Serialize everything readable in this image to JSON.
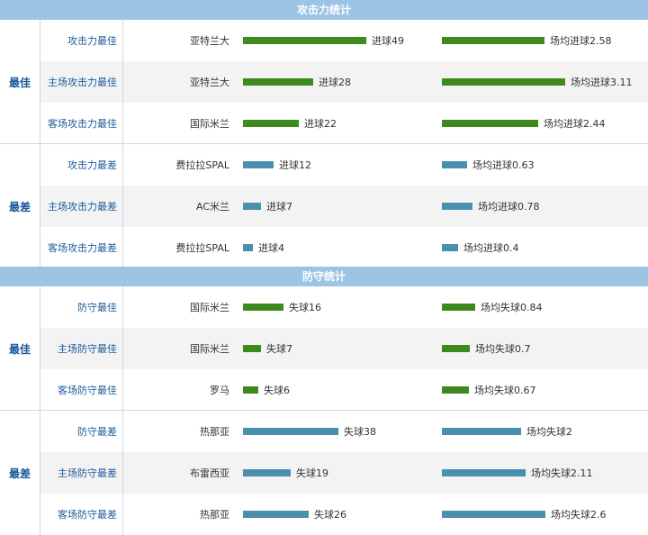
{
  "colors": {
    "header_bg": "#9cc4e4",
    "best_bar": "#3f8a1e",
    "worst_bar": "#4a8fad",
    "label_blue": "#1b5a9a"
  },
  "chart_data": {
    "type": "table",
    "sections": [
      {
        "title": "攻击力统计",
        "groups": [
          {
            "category": "最佳",
            "rows": [
              {
                "label": "攻击力最佳",
                "team": "亚特兰大",
                "total_text": "进球49",
                "total": 49,
                "avg_text": "场均进球2.58",
                "avg": 2.58
              },
              {
                "label": "主场攻击力最佳",
                "team": "亚特兰大",
                "total_text": "进球28",
                "total": 28,
                "avg_text": "场均进球3.11",
                "avg": 3.11
              },
              {
                "label": "客场攻击力最佳",
                "team": "国际米兰",
                "total_text": "进球22",
                "total": 22,
                "avg_text": "场均进球2.44",
                "avg": 2.44
              }
            ]
          },
          {
            "category": "最差",
            "rows": [
              {
                "label": "攻击力最差",
                "team": "费拉拉SPAL",
                "total_text": "进球12",
                "total": 12,
                "avg_text": "场均进球0.63",
                "avg": 0.63
              },
              {
                "label": "主场攻击力最差",
                "team": "AC米兰",
                "total_text": "进球7",
                "total": 7,
                "avg_text": "场均进球0.78",
                "avg": 0.78
              },
              {
                "label": "客场攻击力最差",
                "team": "费拉拉SPAL",
                "total_text": "进球4",
                "total": 4,
                "avg_text": "场均进球0.4",
                "avg": 0.4
              }
            ]
          }
        ]
      },
      {
        "title": "防守统计",
        "groups": [
          {
            "category": "最佳",
            "rows": [
              {
                "label": "防守最佳",
                "team": "国际米兰",
                "total_text": "失球16",
                "total": 16,
                "avg_text": "场均失球0.84",
                "avg": 0.84
              },
              {
                "label": "主场防守最佳",
                "team": "国际米兰",
                "total_text": "失球7",
                "total": 7,
                "avg_text": "场均失球0.7",
                "avg": 0.7
              },
              {
                "label": "客场防守最佳",
                "team": "罗马",
                "total_text": "失球6",
                "total": 6,
                "avg_text": "场均失球0.67",
                "avg": 0.67
              }
            ]
          },
          {
            "category": "最差",
            "rows": [
              {
                "label": "防守最差",
                "team": "热那亚",
                "total_text": "失球38",
                "total": 38,
                "avg_text": "场均失球2",
                "avg": 2
              },
              {
                "label": "主场防守最差",
                "team": "布雷西亚",
                "total_text": "失球19",
                "total": 19,
                "avg_text": "场均失球2.11",
                "avg": 2.11
              },
              {
                "label": "客场防守最差",
                "team": "热那亚",
                "total_text": "失球26",
                "total": 26,
                "avg_text": "场均失球2.6",
                "avg": 2.6
              }
            ]
          }
        ]
      }
    ]
  }
}
